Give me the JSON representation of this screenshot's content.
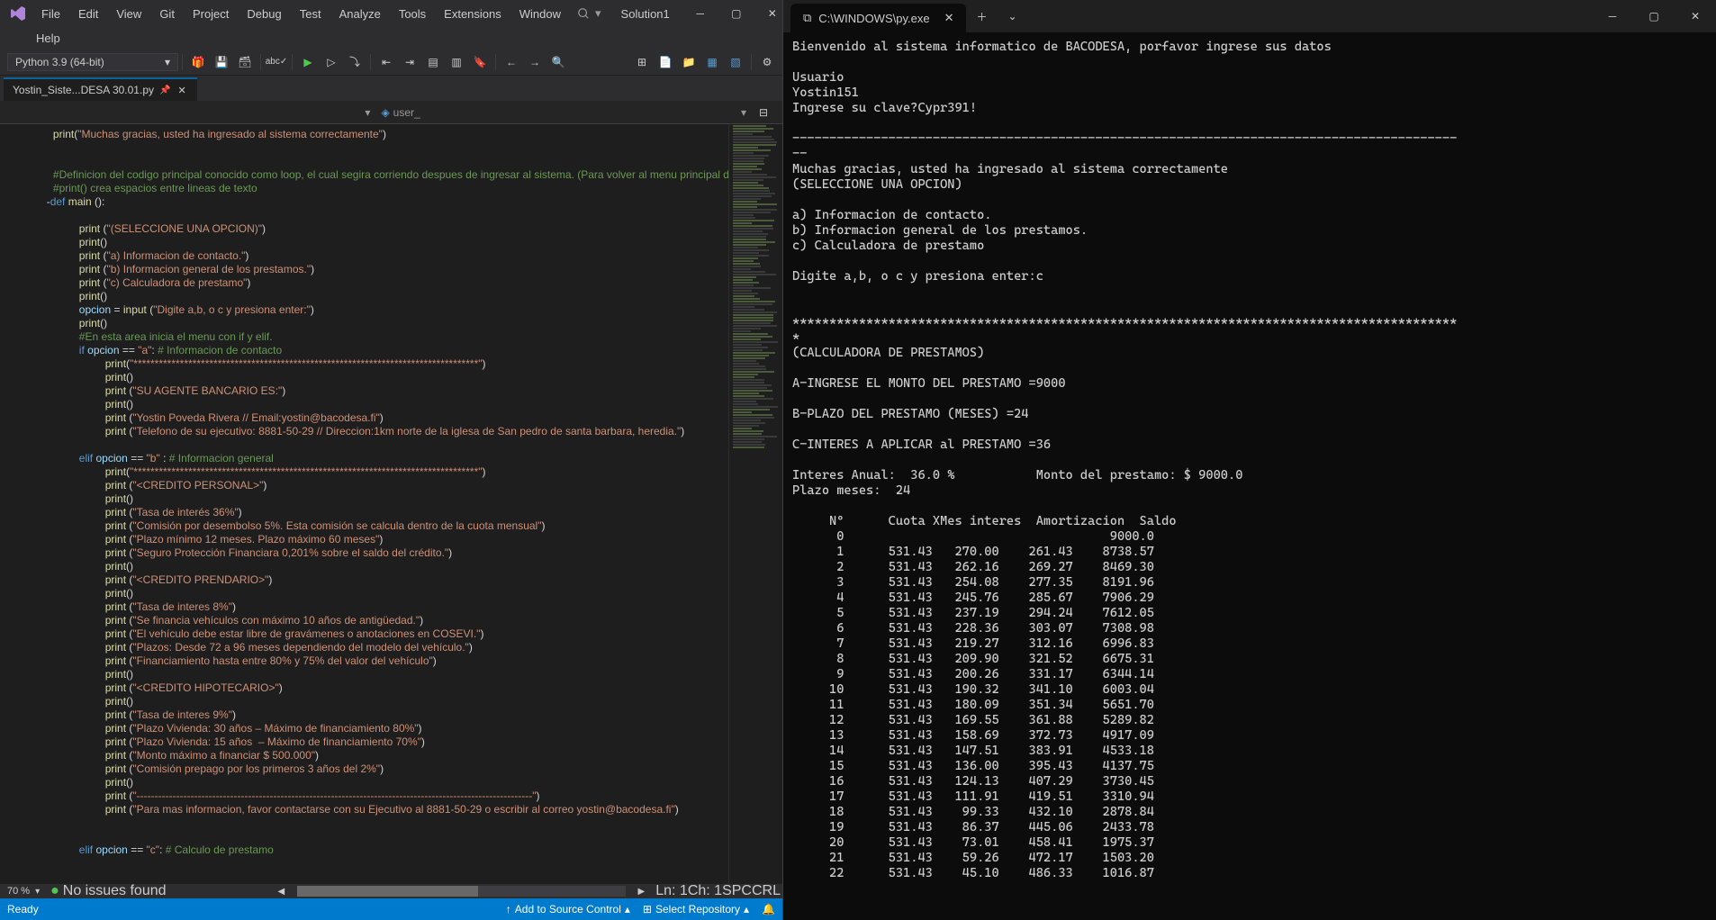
{
  "vs": {
    "menu": [
      "File",
      "Edit",
      "View",
      "Git",
      "Project",
      "Debug",
      "Test",
      "Analyze",
      "Tools",
      "Extensions",
      "Window",
      "Help"
    ],
    "search_placeholder": "Search",
    "solution": "Solution1",
    "python_env": "Python 3.9 (64-bit)",
    "tab_name": "Yostin_Siste...DESA 30.01.py",
    "nav_item": "user_",
    "zoom": "70 %",
    "issues": "No issues found",
    "ln": "Ln: 1",
    "ch": "Ch: 1",
    "spc": "SPC",
    "crlf": "CRL",
    "ready": "Ready",
    "select_repo": "Select Repository",
    "add_src": "Add to Source Control"
  },
  "code": [
    {
      "t": "    ",
      "s": [
        [
          "print",
          "fn"
        ],
        [
          "(",
          "op"
        ],
        [
          "\"Muchas gracias, usted ha ingresado al sistema correctamente\"",
          "str"
        ],
        [
          ")",
          "op"
        ]
      ]
    },
    {
      "t": "",
      "s": []
    },
    {
      "t": "",
      "s": []
    },
    {
      "t": "    ",
      "s": [
        [
          "#Definicion del codigo principal conocido como loop, el cual segira corriendo despues de ingresar al sistema. (Para volver al menu principal del",
          "cm"
        ]
      ]
    },
    {
      "t": "    ",
      "s": [
        [
          "#print() crea espacios entre lineas de texto",
          "cm"
        ]
      ]
    },
    {
      "t": "   ",
      "s": [
        [
          "-",
          "op"
        ],
        [
          "def ",
          "kw"
        ],
        [
          "main",
          "fn"
        ],
        [
          " ():",
          "op"
        ]
      ]
    },
    {
      "t": "",
      "s": []
    },
    {
      "t": "        ",
      "s": [
        [
          "print",
          "fn"
        ],
        [
          " (",
          "op"
        ],
        [
          "\"(SELECCIONE UNA OPCION)\"",
          "str"
        ],
        [
          ")",
          "op"
        ]
      ]
    },
    {
      "t": "        ",
      "s": [
        [
          "print",
          "fn"
        ],
        [
          "()",
          "op"
        ]
      ]
    },
    {
      "t": "        ",
      "s": [
        [
          "print",
          "fn"
        ],
        [
          " (",
          "op"
        ],
        [
          "\"a) Informacion de contacto.\"",
          "str"
        ],
        [
          ")",
          "op"
        ]
      ]
    },
    {
      "t": "        ",
      "s": [
        [
          "print",
          "fn"
        ],
        [
          " (",
          "op"
        ],
        [
          "\"b) Informacion general de los prestamos.\"",
          "str"
        ],
        [
          ")",
          "op"
        ]
      ]
    },
    {
      "t": "        ",
      "s": [
        [
          "print",
          "fn"
        ],
        [
          " (",
          "op"
        ],
        [
          "\"c) Calculadora de prestamo\"",
          "str"
        ],
        [
          ")",
          "op"
        ]
      ]
    },
    {
      "t": "        ",
      "s": [
        [
          "print",
          "fn"
        ],
        [
          "()",
          "op"
        ]
      ]
    },
    {
      "t": "        ",
      "s": [
        [
          "opcion",
          "id"
        ],
        [
          " = ",
          "op"
        ],
        [
          "input",
          "fn"
        ],
        [
          " (",
          "op"
        ],
        [
          "\"Digite a,b, o c y presiona enter:\"",
          "str"
        ],
        [
          ")",
          "op"
        ]
      ]
    },
    {
      "t": "        ",
      "s": [
        [
          "print",
          "fn"
        ],
        [
          "()",
          "op"
        ]
      ]
    },
    {
      "t": "        ",
      "s": [
        [
          "#En esta area inicia el menu con if y elif.",
          "cm"
        ]
      ]
    },
    {
      "t": "        ",
      "s": [
        [
          "if ",
          "kw"
        ],
        [
          "opcion",
          "id"
        ],
        [
          " == ",
          "op"
        ],
        [
          "\"a\"",
          "str"
        ],
        [
          ": ",
          "op"
        ],
        [
          "# Informacion de contacto",
          "cm"
        ]
      ]
    },
    {
      "t": "            ",
      "s": [
        [
          "print",
          "fn"
        ],
        [
          "(",
          "op"
        ],
        [
          "\"**********************************************************************************\"",
          "str"
        ],
        [
          ")",
          "op"
        ]
      ]
    },
    {
      "t": "            ",
      "s": [
        [
          "print",
          "fn"
        ],
        [
          "()",
          "op"
        ]
      ]
    },
    {
      "t": "            ",
      "s": [
        [
          "print",
          "fn"
        ],
        [
          " (",
          "op"
        ],
        [
          "\"SU AGENTE BANCARIO ES:\"",
          "str"
        ],
        [
          ")",
          "op"
        ]
      ]
    },
    {
      "t": "            ",
      "s": [
        [
          "print",
          "fn"
        ],
        [
          "()",
          "op"
        ]
      ]
    },
    {
      "t": "            ",
      "s": [
        [
          "print",
          "fn"
        ],
        [
          " (",
          "op"
        ],
        [
          "\"Yostin Poveda Rivera // Email:yostin@bacodesa.fi\"",
          "str"
        ],
        [
          ")",
          "op"
        ]
      ]
    },
    {
      "t": "            ",
      "s": [
        [
          "print",
          "fn"
        ],
        [
          " (",
          "op"
        ],
        [
          "\"Telefono de su ejecutivo: 8881-50-29 // Direccion:1km norte de la iglesa de San pedro de santa barbara, heredia.\"",
          "str"
        ],
        [
          ")",
          "op"
        ]
      ]
    },
    {
      "t": "",
      "s": []
    },
    {
      "t": "        ",
      "s": [
        [
          "elif ",
          "kw"
        ],
        [
          "opcion",
          "id"
        ],
        [
          " == ",
          "op"
        ],
        [
          "\"b\"",
          "str"
        ],
        [
          " : ",
          "op"
        ],
        [
          "# Informacion general",
          "cm"
        ]
      ]
    },
    {
      "t": "            ",
      "s": [
        [
          "print",
          "fn"
        ],
        [
          "(",
          "op"
        ],
        [
          "\"**********************************************************************************\"",
          "str"
        ],
        [
          ")",
          "op"
        ]
      ]
    },
    {
      "t": "            ",
      "s": [
        [
          "print",
          "fn"
        ],
        [
          " (",
          "op"
        ],
        [
          "\"<CREDITO PERSONAL>\"",
          "str"
        ],
        [
          ")",
          "op"
        ]
      ]
    },
    {
      "t": "            ",
      "s": [
        [
          "print",
          "fn"
        ],
        [
          "()",
          "op"
        ]
      ]
    },
    {
      "t": "            ",
      "s": [
        [
          "print",
          "fn"
        ],
        [
          " (",
          "op"
        ],
        [
          "\"Tasa de interés 36%\"",
          "str"
        ],
        [
          ")",
          "op"
        ]
      ]
    },
    {
      "t": "            ",
      "s": [
        [
          "print",
          "fn"
        ],
        [
          " (",
          "op"
        ],
        [
          "\"Comisión por desembolso 5%. Esta comisión se calcula dentro de la cuota mensual\"",
          "str"
        ],
        [
          ")",
          "op"
        ]
      ]
    },
    {
      "t": "            ",
      "s": [
        [
          "print",
          "fn"
        ],
        [
          " (",
          "op"
        ],
        [
          "\"Plazo mínimo 12 meses. Plazo máximo 60 meses\"",
          "str"
        ],
        [
          ")",
          "op"
        ]
      ]
    },
    {
      "t": "            ",
      "s": [
        [
          "print",
          "fn"
        ],
        [
          " (",
          "op"
        ],
        [
          "\"Seguro Protección Financiara 0,201% sobre el saldo del crédito.\"",
          "str"
        ],
        [
          ")",
          "op"
        ]
      ]
    },
    {
      "t": "            ",
      "s": [
        [
          "print",
          "fn"
        ],
        [
          "()",
          "op"
        ]
      ]
    },
    {
      "t": "            ",
      "s": [
        [
          "print",
          "fn"
        ],
        [
          " (",
          "op"
        ],
        [
          "\"<CREDITO PRENDARIO>\"",
          "str"
        ],
        [
          ")",
          "op"
        ]
      ]
    },
    {
      "t": "            ",
      "s": [
        [
          "print",
          "fn"
        ],
        [
          "()",
          "op"
        ]
      ]
    },
    {
      "t": "            ",
      "s": [
        [
          "print",
          "fn"
        ],
        [
          " (",
          "op"
        ],
        [
          "\"Tasa de interes 8%\"",
          "str"
        ],
        [
          ")",
          "op"
        ]
      ]
    },
    {
      "t": "            ",
      "s": [
        [
          "print",
          "fn"
        ],
        [
          " (",
          "op"
        ],
        [
          "\"Se financia vehículos con máximo 10 años de antigüedad.\"",
          "str"
        ],
        [
          ")",
          "op"
        ]
      ]
    },
    {
      "t": "            ",
      "s": [
        [
          "print",
          "fn"
        ],
        [
          " (",
          "op"
        ],
        [
          "\"El vehículo debe estar libre de gravámenes o anotaciones en COSEVI.\"",
          "str"
        ],
        [
          ")",
          "op"
        ]
      ]
    },
    {
      "t": "            ",
      "s": [
        [
          "print",
          "fn"
        ],
        [
          " (",
          "op"
        ],
        [
          "\"Plazos: Desde 72 a 96 meses dependiendo del modelo del vehículo.\"",
          "str"
        ],
        [
          ")",
          "op"
        ]
      ]
    },
    {
      "t": "            ",
      "s": [
        [
          "print",
          "fn"
        ],
        [
          " (",
          "op"
        ],
        [
          "\"Financiamiento hasta entre 80% y 75% del valor del vehículo\"",
          "str"
        ],
        [
          ")",
          "op"
        ]
      ]
    },
    {
      "t": "            ",
      "s": [
        [
          "print",
          "fn"
        ],
        [
          "()",
          "op"
        ]
      ]
    },
    {
      "t": "            ",
      "s": [
        [
          "print",
          "fn"
        ],
        [
          " (",
          "op"
        ],
        [
          "\"<CREDITO HIPOTECARIO>\"",
          "str"
        ],
        [
          ")",
          "op"
        ]
      ]
    },
    {
      "t": "            ",
      "s": [
        [
          "print",
          "fn"
        ],
        [
          "()",
          "op"
        ]
      ]
    },
    {
      "t": "            ",
      "s": [
        [
          "print",
          "fn"
        ],
        [
          " (",
          "op"
        ],
        [
          "\"Tasa de interes 9%\"",
          "str"
        ],
        [
          ")",
          "op"
        ]
      ]
    },
    {
      "t": "            ",
      "s": [
        [
          "print",
          "fn"
        ],
        [
          " (",
          "op"
        ],
        [
          "\"Plazo Vivienda: 30 años – Máximo de financiamiento 80%\"",
          "str"
        ],
        [
          ")",
          "op"
        ]
      ]
    },
    {
      "t": "            ",
      "s": [
        [
          "print",
          "fn"
        ],
        [
          " (",
          "op"
        ],
        [
          "\"Plazo Vivienda: 15 años  – Máximo de financiamiento 70%\"",
          "str"
        ],
        [
          ")",
          "op"
        ]
      ]
    },
    {
      "t": "            ",
      "s": [
        [
          "print",
          "fn"
        ],
        [
          " (",
          "op"
        ],
        [
          "\"Monto máximo a financiar $ 500.000\"",
          "str"
        ],
        [
          ")",
          "op"
        ]
      ]
    },
    {
      "t": "            ",
      "s": [
        [
          "print",
          "fn"
        ],
        [
          " (",
          "op"
        ],
        [
          "\"Comisión prepago por los primeros 3 años del 2%\"",
          "str"
        ],
        [
          ")",
          "op"
        ]
      ]
    },
    {
      "t": "            ",
      "s": [
        [
          "print",
          "fn"
        ],
        [
          "()",
          "op"
        ]
      ]
    },
    {
      "t": "            ",
      "s": [
        [
          "print",
          "fn"
        ],
        [
          " (",
          "op"
        ],
        [
          "\"--------------------------------------------------------------------------------------------------------------\"",
          "str"
        ],
        [
          ")",
          "op"
        ]
      ]
    },
    {
      "t": "            ",
      "s": [
        [
          "print",
          "fn"
        ],
        [
          " (",
          "op"
        ],
        [
          "\"Para mas informacion, favor contactarse con su Ejecutivo al 8881-50-29 o escribir al correo yostin@bacodesa.fi\"",
          "str"
        ],
        [
          ")",
          "op"
        ]
      ]
    },
    {
      "t": "",
      "s": []
    },
    {
      "t": "",
      "s": []
    },
    {
      "t": "        ",
      "s": [
        [
          "elif ",
          "kw"
        ],
        [
          "opcion",
          "id"
        ],
        [
          " == ",
          "op"
        ],
        [
          "\"c\"",
          "str"
        ],
        [
          ": ",
          "op"
        ],
        [
          "# Calculo de prestamo",
          "cm"
        ]
      ]
    }
  ],
  "terminal": {
    "title": "C:\\WINDOWS\\py.exe",
    "lines": [
      "Bienvenido al sistema informatico de BACODESA, porfavor ingrese sus datos",
      "",
      "Usuario",
      "Yostin151",
      "Ingrese su clave?Cypr391!",
      "",
      "------------------------------------------------------------------------------------------",
      "--",
      "Muchas gracias, usted ha ingresado al sistema correctamente",
      "(SELECCIONE UNA OPCION)",
      "",
      "a) Informacion de contacto.",
      "b) Informacion general de los prestamos.",
      "c) Calculadora de prestamo",
      "",
      "Digite a,b, o c y presiona enter:c",
      "",
      "",
      "******************************************************************************************",
      "*",
      "(CALCULADORA DE PRESTAMOS)",
      "",
      "A-INGRESE EL MONTO DEL PRESTAMO =9000",
      "",
      "B-PLAZO DEL PRESTAMO (MESES) =24",
      "",
      "C-INTERES A APLICAR al PRESTAMO =36",
      "",
      "Interes Anual:  36.0 %           Monto del prestamo: $ 9000.0",
      "Plazo meses:  24",
      ""
    ],
    "table": {
      "header": [
        "Nº",
        "Cuota XMes",
        "interes",
        "Amortizacion",
        "Saldo"
      ],
      "rows": [
        [
          "0",
          "",
          "",
          "",
          "9000.0"
        ],
        [
          "1",
          "531.43",
          "270.00",
          "261.43",
          "8738.57"
        ],
        [
          "2",
          "531.43",
          "262.16",
          "269.27",
          "8469.30"
        ],
        [
          "3",
          "531.43",
          "254.08",
          "277.35",
          "8191.96"
        ],
        [
          "4",
          "531.43",
          "245.76",
          "285.67",
          "7906.29"
        ],
        [
          "5",
          "531.43",
          "237.19",
          "294.24",
          "7612.05"
        ],
        [
          "6",
          "531.43",
          "228.36",
          "303.07",
          "7308.98"
        ],
        [
          "7",
          "531.43",
          "219.27",
          "312.16",
          "6996.83"
        ],
        [
          "8",
          "531.43",
          "209.90",
          "321.52",
          "6675.31"
        ],
        [
          "9",
          "531.43",
          "200.26",
          "331.17",
          "6344.14"
        ],
        [
          "10",
          "531.43",
          "190.32",
          "341.10",
          "6003.04"
        ],
        [
          "11",
          "531.43",
          "180.09",
          "351.34",
          "5651.70"
        ],
        [
          "12",
          "531.43",
          "169.55",
          "361.88",
          "5289.82"
        ],
        [
          "13",
          "531.43",
          "158.69",
          "372.73",
          "4917.09"
        ],
        [
          "14",
          "531.43",
          "147.51",
          "383.91",
          "4533.18"
        ],
        [
          "15",
          "531.43",
          "136.00",
          "395.43",
          "4137.75"
        ],
        [
          "16",
          "531.43",
          "124.13",
          "407.29",
          "3730.45"
        ],
        [
          "17",
          "531.43",
          "111.91",
          "419.51",
          "3310.94"
        ],
        [
          "18",
          "531.43",
          "99.33",
          "432.10",
          "2878.84"
        ],
        [
          "19",
          "531.43",
          "86.37",
          "445.06",
          "2433.78"
        ],
        [
          "20",
          "531.43",
          "73.01",
          "458.41",
          "1975.37"
        ],
        [
          "21",
          "531.43",
          "59.26",
          "472.17",
          "1503.20"
        ],
        [
          "22",
          "531.43",
          "45.10",
          "486.33",
          "1016.87"
        ]
      ]
    }
  }
}
